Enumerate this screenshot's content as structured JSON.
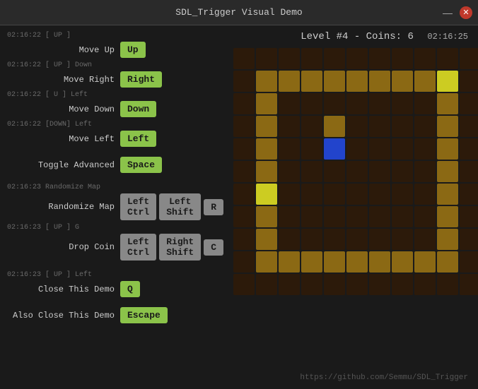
{
  "titlebar": {
    "title": "SDL_Trigger Visual Demo",
    "minimize": "—",
    "close": "✕"
  },
  "clock": "02:16:25",
  "footer_link": "https://github.com/Semmu/SDL_Trigger",
  "level_info": "Level #4 - Coins: 6",
  "actions": [
    {
      "timestamp": "02:16:22   [ UP ]",
      "label": "Move Up",
      "keys": [
        "Up"
      ]
    },
    {
      "timestamp": "02:16:22 [ UP ] Down",
      "label": "Move Right",
      "keys": [
        "Right"
      ]
    },
    {
      "timestamp": "02:16:22 [ U ] Left",
      "label": "Move Down",
      "keys": [
        "Down"
      ]
    },
    {
      "timestamp": "02:16:22 [DOWN] Left",
      "label": "Move Left",
      "keys": [
        "Left"
      ]
    },
    {
      "timestamp": "",
      "label": "Toggle Advanced",
      "keys": [
        "Space"
      ]
    }
  ],
  "randomize": {
    "timestamp": "02:16:23 Randomize Map",
    "label": "Randomize Map",
    "keys": [
      "Left Ctrl",
      "Left Shift",
      "R"
    ]
  },
  "dropcoin": {
    "timestamp": "02:16:23 [ UP ] G",
    "label": "Drop Coin",
    "keys": [
      "Left Ctrl",
      "Right Shift",
      "C"
    ]
  },
  "closedemo": {
    "timestamp": "02:16:23 [ UP ] Left",
    "label": "Close This Demo",
    "keys": [
      "Q"
    ]
  },
  "alsoclosedemo": {
    "label": "Also Close This Demo",
    "keys": [
      "Escape"
    ]
  },
  "grid": {
    "cols": 11,
    "rows": 11,
    "cells": [
      "b",
      "b",
      "b",
      "b",
      "b",
      "b",
      "b",
      "b",
      "b",
      "b",
      "b",
      "b",
      "w",
      "w",
      "w",
      "w",
      "w",
      "w",
      "w",
      "w",
      "Y",
      "b",
      "b",
      "w",
      "b",
      "b",
      "b",
      "b",
      "b",
      "b",
      "b",
      "w",
      "b",
      "b",
      "w",
      "b",
      "b",
      "w",
      "b",
      "b",
      "b",
      "b",
      "w",
      "b",
      "b",
      "w",
      "b",
      "b",
      "B",
      "b",
      "b",
      "b",
      "b",
      "w",
      "b",
      "b",
      "w",
      "b",
      "b",
      "b",
      "b",
      "b",
      "b",
      "b",
      "w",
      "b",
      "b",
      "Y",
      "b",
      "b",
      "b",
      "b",
      "b",
      "b",
      "b",
      "w",
      "b",
      "b",
      "w",
      "b",
      "b",
      "b",
      "b",
      "b",
      "b",
      "b",
      "w",
      "b",
      "b",
      "w",
      "b",
      "b",
      "b",
      "b",
      "b",
      "b",
      "b",
      "w",
      "b",
      "b",
      "w",
      "w",
      "w",
      "w",
      "w",
      "w",
      "w",
      "w",
      "w",
      "b",
      "b",
      "b",
      "b",
      "b",
      "b",
      "b",
      "b",
      "b",
      "b",
      "b",
      "b"
    ]
  }
}
